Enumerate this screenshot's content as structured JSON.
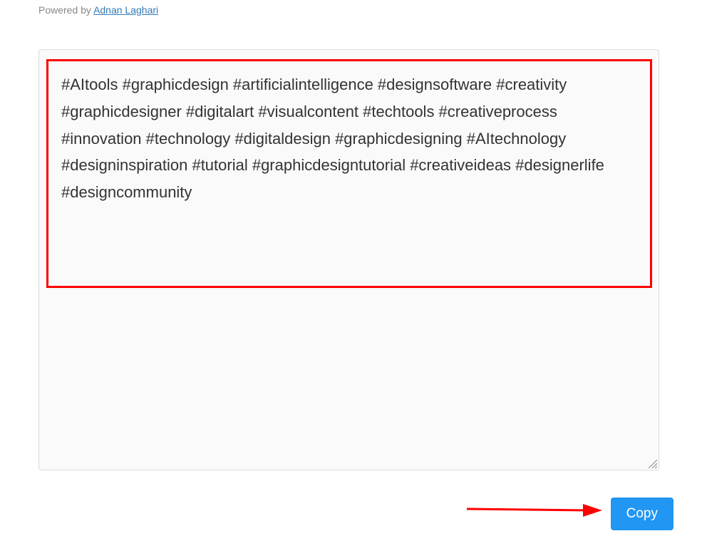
{
  "header": {
    "powered_by_prefix": "Powered by ",
    "powered_by_link_text": "Adnan Laghari"
  },
  "output": {
    "hashtags": "#AItools #graphicdesign #artificialintelligence #designsoftware #creativity #graphicdesigner #digitalart #visualcontent #techtools #creativeprocess #innovation #technology #digitaldesign #graphicdesigning #AItechnology #designinspiration #tutorial #graphicdesigntutorial #creativeideas #designerlife #designcommunity"
  },
  "actions": {
    "copy_label": "Copy"
  },
  "annotations": {
    "highlight_color": "#ff0000",
    "arrow_color": "#ff0000"
  }
}
